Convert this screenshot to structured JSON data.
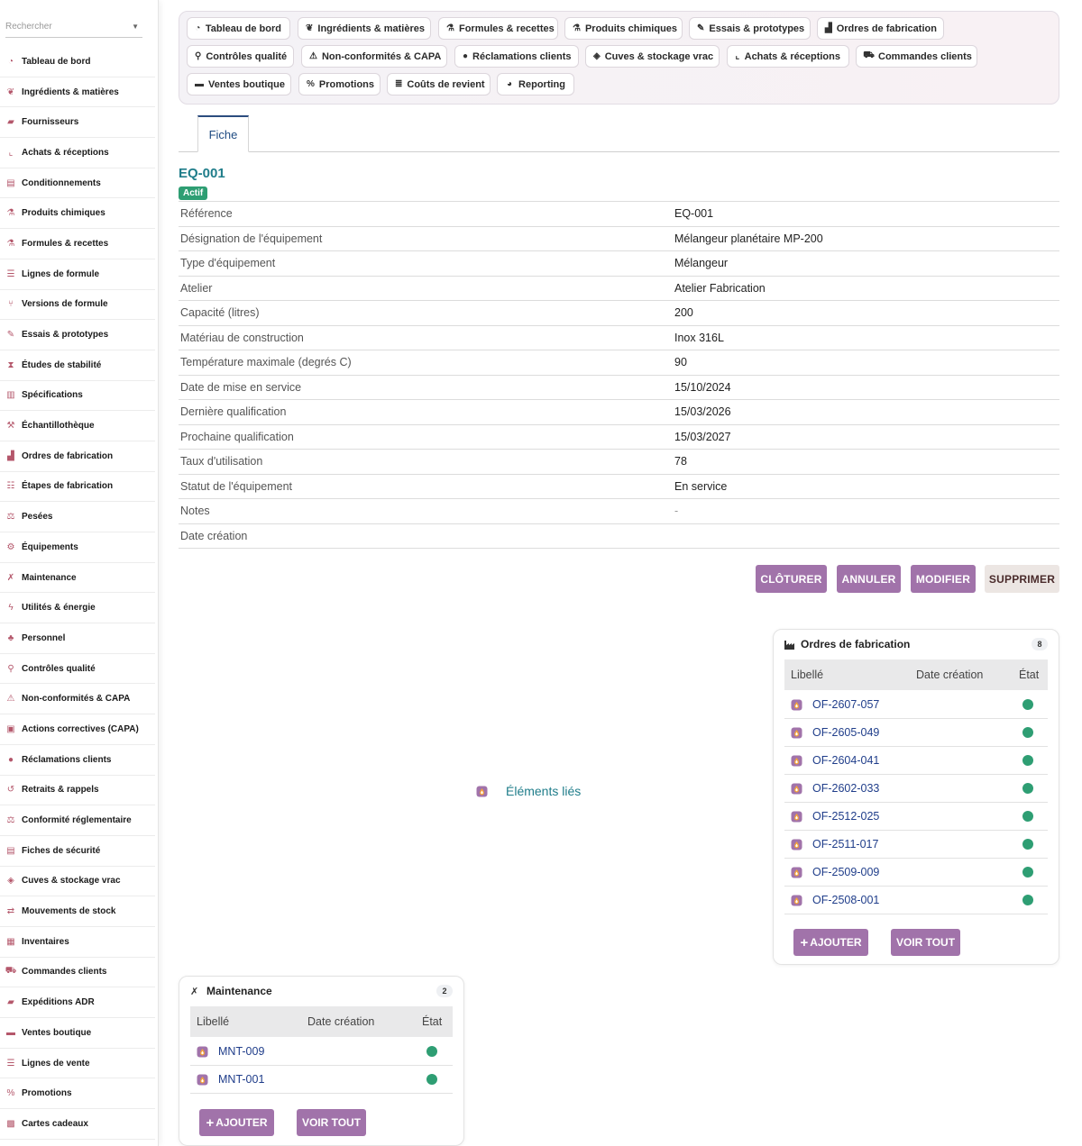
{
  "search": {
    "placeholder": "Rechercher"
  },
  "sidebar": {
    "items": [
      {
        "label": "Tableau de bord",
        "icon": "dashboard-icon"
      },
      {
        "label": "Ingrédients & matières",
        "icon": "leaf-icon"
      },
      {
        "label": "Fournisseurs",
        "icon": "truck-icon"
      },
      {
        "label": "Achats & réceptions",
        "icon": "dolly-icon"
      },
      {
        "label": "Conditionnements",
        "icon": "box-icon"
      },
      {
        "label": "Produits chimiques",
        "icon": "spray-icon"
      },
      {
        "label": "Formules & recettes",
        "icon": "flask-icon"
      },
      {
        "label": "Lignes de formule",
        "icon": "list-icon"
      },
      {
        "label": "Versions de formule",
        "icon": "branch-icon"
      },
      {
        "label": "Essais & prototypes",
        "icon": "pipette-icon"
      },
      {
        "label": "Études de stabilité",
        "icon": "hourglass-icon"
      },
      {
        "label": "Spécifications",
        "icon": "clipboard-icon"
      },
      {
        "label": "Échantillothèque",
        "icon": "hammer-icon"
      },
      {
        "label": "Ordres de fabrication",
        "icon": "industry-icon"
      },
      {
        "label": "Étapes de fabrication",
        "icon": "list-ol-icon"
      },
      {
        "label": "Pesées",
        "icon": "scale-icon"
      },
      {
        "label": "Équipements",
        "icon": "cogs-icon"
      },
      {
        "label": "Maintenance",
        "icon": "tools-icon"
      },
      {
        "label": "Utilités & énergie",
        "icon": "bolt-icon"
      },
      {
        "label": "Personnel",
        "icon": "users-icon"
      },
      {
        "label": "Contrôles qualité",
        "icon": "microscope-icon"
      },
      {
        "label": "Non-conformités & CAPA",
        "icon": "warning-icon"
      },
      {
        "label": "Actions correctives (CAPA)",
        "icon": "clipboard-check-icon"
      },
      {
        "label": "Réclamations clients",
        "icon": "comment-icon"
      },
      {
        "label": "Retraits & rappels",
        "icon": "undo-icon"
      },
      {
        "label": "Conformité réglementaire",
        "icon": "balance-icon"
      },
      {
        "label": "Fiches de sécurité",
        "icon": "document-icon"
      },
      {
        "label": "Cuves & stockage vrac",
        "icon": "bucket-icon"
      },
      {
        "label": "Mouvements de stock",
        "icon": "arrows-icon"
      },
      {
        "label": "Inventaires",
        "icon": "boxes-icon"
      },
      {
        "label": "Commandes clients",
        "icon": "cart-icon"
      },
      {
        "label": "Expéditions ADR",
        "icon": "truck-icon"
      },
      {
        "label": "Ventes boutique",
        "icon": "register-icon"
      },
      {
        "label": "Lignes de vente",
        "icon": "list-icon"
      },
      {
        "label": "Promotions",
        "icon": "percent-icon"
      },
      {
        "label": "Cartes cadeaux",
        "icon": "gift-icon"
      }
    ]
  },
  "topnav": {
    "chips": [
      {
        "label": "Tableau de bord",
        "icon": "dashboard-icon"
      },
      {
        "label": "Ingrédients & matières",
        "icon": "leaf-icon"
      },
      {
        "label": "Formules & recettes",
        "icon": "flask-icon"
      },
      {
        "label": "Produits chimiques",
        "icon": "spray-icon"
      },
      {
        "label": "Essais & prototypes",
        "icon": "pipette-icon"
      },
      {
        "label": "Ordres de fabrication",
        "icon": "industry-icon"
      },
      {
        "label": "Contrôles qualité",
        "icon": "microscope-icon"
      },
      {
        "label": "Non-conformités & CAPA",
        "icon": "warning-icon"
      },
      {
        "label": "Réclamations clients",
        "icon": "comment-icon"
      },
      {
        "label": "Cuves & stockage vrac",
        "icon": "bucket-icon"
      },
      {
        "label": "Achats & réceptions",
        "icon": "dolly-icon"
      },
      {
        "label": "Commandes clients",
        "icon": "cart-icon"
      },
      {
        "label": "Ventes boutique",
        "icon": "register-icon"
      },
      {
        "label": "Promotions",
        "icon": "percent-icon"
      },
      {
        "label": "Coûts de revient",
        "icon": "coins-icon"
      },
      {
        "label": "Reporting",
        "icon": "pie-chart-icon"
      }
    ]
  },
  "tabs": {
    "fiche": "Fiche"
  },
  "record": {
    "title": "EQ-001",
    "status_badge": "Actif",
    "fields": [
      {
        "label": "Référence",
        "value": "EQ-001"
      },
      {
        "label": "Désignation de l'équipement",
        "value": "Mélangeur planétaire MP-200"
      },
      {
        "label": "Type d'équipement",
        "value": "Mélangeur"
      },
      {
        "label": "Atelier",
        "value": "Atelier Fabrication"
      },
      {
        "label": "Capacité (litres)",
        "value": "200"
      },
      {
        "label": "Matériau de construction",
        "value": "Inox 316L"
      },
      {
        "label": "Température maximale (degrés C)",
        "value": "90"
      },
      {
        "label": "Date de mise en service",
        "value": "15/10/2024"
      },
      {
        "label": "Dernière qualification",
        "value": "15/03/2026"
      },
      {
        "label": "Prochaine qualification",
        "value": "15/03/2027"
      },
      {
        "label": "Taux d'utilisation",
        "value": "78"
      },
      {
        "label": "Statut de l'équipement",
        "value": "En service"
      },
      {
        "label": "Notes",
        "value": "-"
      },
      {
        "label": "Date création",
        "value": ""
      }
    ]
  },
  "actions": {
    "cloturer": "CLÔTURER",
    "annuler": "ANNULER",
    "modifier": "MODIFIER",
    "supprimer": "SUPPRIMER"
  },
  "linked": {
    "label": "Éléments liés"
  },
  "orders_card": {
    "title": "Ordres de fabrication",
    "count": "8",
    "columns": {
      "label": "Libellé",
      "date": "Date création",
      "state": "État"
    },
    "rows": [
      "OF-2607-057",
      "OF-2605-049",
      "OF-2604-041",
      "OF-2602-033",
      "OF-2512-025",
      "OF-2511-017",
      "OF-2509-009",
      "OF-2508-001"
    ],
    "add": "AJOUTER",
    "view_all": "VOIR TOUT"
  },
  "maintenance_card": {
    "title": "Maintenance",
    "count": "2",
    "columns": {
      "label": "Libellé",
      "date": "Date création",
      "state": "État"
    },
    "rows": [
      "MNT-009",
      "MNT-001"
    ],
    "add": "AJOUTER",
    "view_all": "VOIR TOUT"
  },
  "colors": {
    "accent": "#a173aa",
    "teal": "#1f7d8a",
    "status_green": "#2e9e73",
    "link_blue": "#1f3d8a",
    "sidebar_icon": "#b4576b"
  }
}
